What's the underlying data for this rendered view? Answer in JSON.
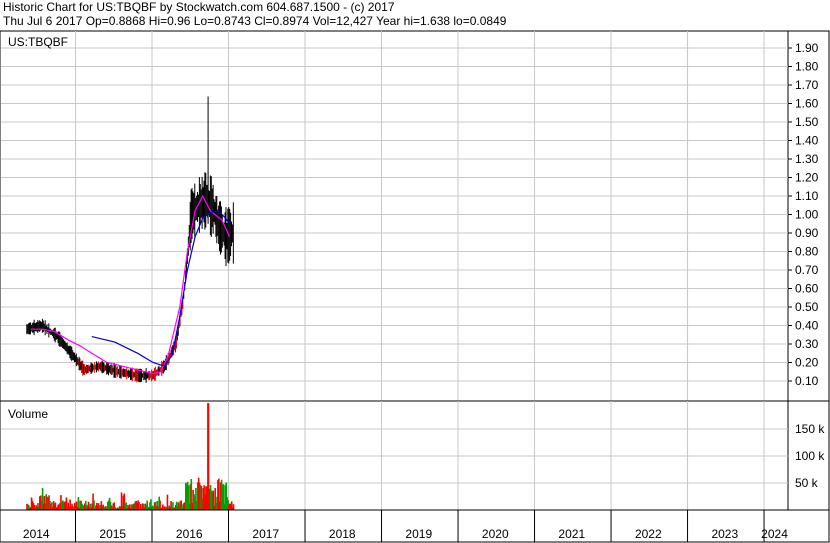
{
  "header": {
    "line1": "Historic Chart for US:TBQBF by Stockwatch.com 604.687.1500 - (c) 2017",
    "line2": "Thu Jul  6 2017   Op=0.8868   Hi=0.96   Lo=0.8743   Cl=0.8974   Vol=12,427   Year hi=1.638   lo=0.0849"
  },
  "chart_data": [
    {
      "type": "line",
      "title": "US:TBQBF",
      "ylim": [
        0,
        2.0
      ],
      "yticks": [
        "0.10",
        "0.20",
        "0.30",
        "0.40",
        "0.50",
        "0.60",
        "0.70",
        "0.80",
        "0.90",
        "1.00",
        "1.10",
        "1.20",
        "1.30",
        "1.40",
        "1.50",
        "1.60",
        "1.70",
        "1.80",
        "1.90"
      ],
      "grid": true,
      "xlim": [
        2014.0,
        2024.3
      ],
      "series": [
        {
          "name": "",
          "color": "#ff00ff",
          "x": [
            2014.4,
            2014.55,
            2014.7,
            2014.9,
            2015.05,
            2015.2,
            2015.4,
            2015.6,
            2015.8,
            2016.0,
            2016.1,
            2016.2,
            2016.35,
            2016.45,
            2016.55,
            2016.65,
            2016.75,
            2016.9,
            2017.0
          ],
          "values": [
            0.38,
            0.38,
            0.37,
            0.32,
            0.29,
            0.25,
            0.2,
            0.18,
            0.16,
            0.14,
            0.15,
            0.24,
            0.5,
            0.8,
            1.02,
            1.1,
            1.02,
            0.97,
            0.88
          ]
        },
        {
          "name": "",
          "color": "#0000cc",
          "x": [
            2015.2,
            2015.5,
            2015.8,
            2016.0,
            2016.15,
            2016.25,
            2016.35,
            2016.45,
            2016.55,
            2016.65,
            2016.75,
            2016.85,
            2016.95,
            2017.0
          ],
          "values": [
            0.34,
            0.31,
            0.25,
            0.2,
            0.18,
            0.24,
            0.45,
            0.7,
            0.88,
            0.98,
            1.01,
            1.02,
            0.98,
            0.95
          ]
        }
      ]
    },
    {
      "type": "bar",
      "title": "Volume",
      "ylim": [
        0,
        200
      ],
      "yticks": [
        "50 k",
        "100 k",
        "150 k"
      ],
      "tick_values": [
        50,
        100,
        150
      ],
      "grid": true,
      "up_color": "#00a000",
      "down_color": "#ff0000"
    }
  ],
  "x_axis": {
    "labels": [
      "2014",
      "2015",
      "2016",
      "2017",
      "2018",
      "2019",
      "2020",
      "2021",
      "2022",
      "2023",
      "2024"
    ]
  }
}
